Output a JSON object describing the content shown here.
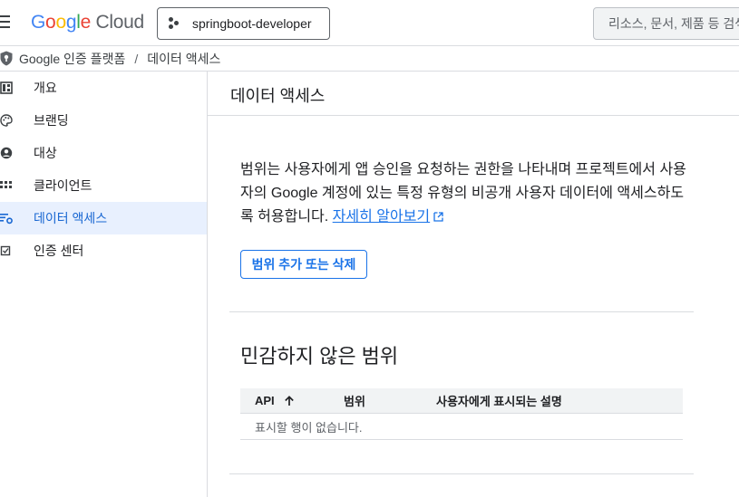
{
  "header": {
    "logo": {
      "g1": "G",
      "g2": "o",
      "g3": "o",
      "g4": "g",
      "g5": "l",
      "g6": "e",
      "cloud": "Cloud"
    },
    "project": "springboot-developer",
    "search_placeholder": "리소스, 문서, 제품 등 검색"
  },
  "breadcrumb": {
    "root": "Google 인증 플랫폼",
    "separator": "/",
    "current": "데이터 액세스"
  },
  "sidebar": {
    "items": [
      {
        "label": "개요",
        "icon": "dashboard-icon"
      },
      {
        "label": "브랜딩",
        "icon": "palette-icon"
      },
      {
        "label": "대상",
        "icon": "account-circle-icon"
      },
      {
        "label": "클라이언트",
        "icon": "apps-grid-icon"
      },
      {
        "label": "데이터 액세스",
        "icon": "data-access-icon",
        "active": true
      },
      {
        "label": "인증 센터",
        "icon": "verified-checkbox-icon"
      }
    ]
  },
  "main": {
    "title": "데이터 액세스",
    "description": "범위는 사용자에게 앱 승인을 요청하는 권한을 나타내며 프로젝트에서 사용자의 Google 계정에 있는 특정 유형의 비공개 사용자 데이터에 액세스하도록 허용합니다.",
    "learn_more": "자세히 알아보기",
    "scope_button": "범위 추가 또는 삭제",
    "section_title": "민감하지 않은 범위",
    "table": {
      "columns": [
        "API",
        "범위",
        "사용자에게 표시되는 설명"
      ],
      "empty": "표시할 행이 없습니다."
    }
  },
  "colors": {
    "accent": "#1a73e8",
    "active_bg": "#e8f0fe",
    "active_text": "#1967d2"
  }
}
